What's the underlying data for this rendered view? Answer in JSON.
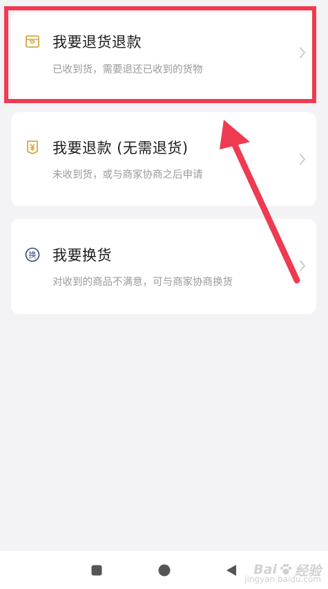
{
  "options": [
    {
      "title": "我要退货退款",
      "subtitle": "已收到货，需要退还已收到的货物",
      "icon": "return-box-icon"
    },
    {
      "title": "我要退款 (无需退货)",
      "subtitle": "未收到货，或与商家协商之后申请",
      "icon": "yuan-refund-icon"
    },
    {
      "title": "我要换货",
      "subtitle": "对收到的商品不满意，可与商家协商换货",
      "icon": "exchange-icon",
      "icon_glyph": "换"
    }
  ],
  "navbar": {
    "recent": "square-recent-icon",
    "home": "circle-home-icon",
    "back": "triangle-back-icon"
  },
  "watermark": {
    "brand": "Bai",
    "suffix": "经验",
    "site": "jingyan.baidu.com"
  },
  "colors": {
    "background": "#f3f2f4",
    "card": "#ffffff",
    "title": "#1c1c1c",
    "subtitle": "#9a9a9a",
    "icon_accent": "#d4a73f",
    "highlight": "#ee3b52",
    "nav": "#555555"
  }
}
